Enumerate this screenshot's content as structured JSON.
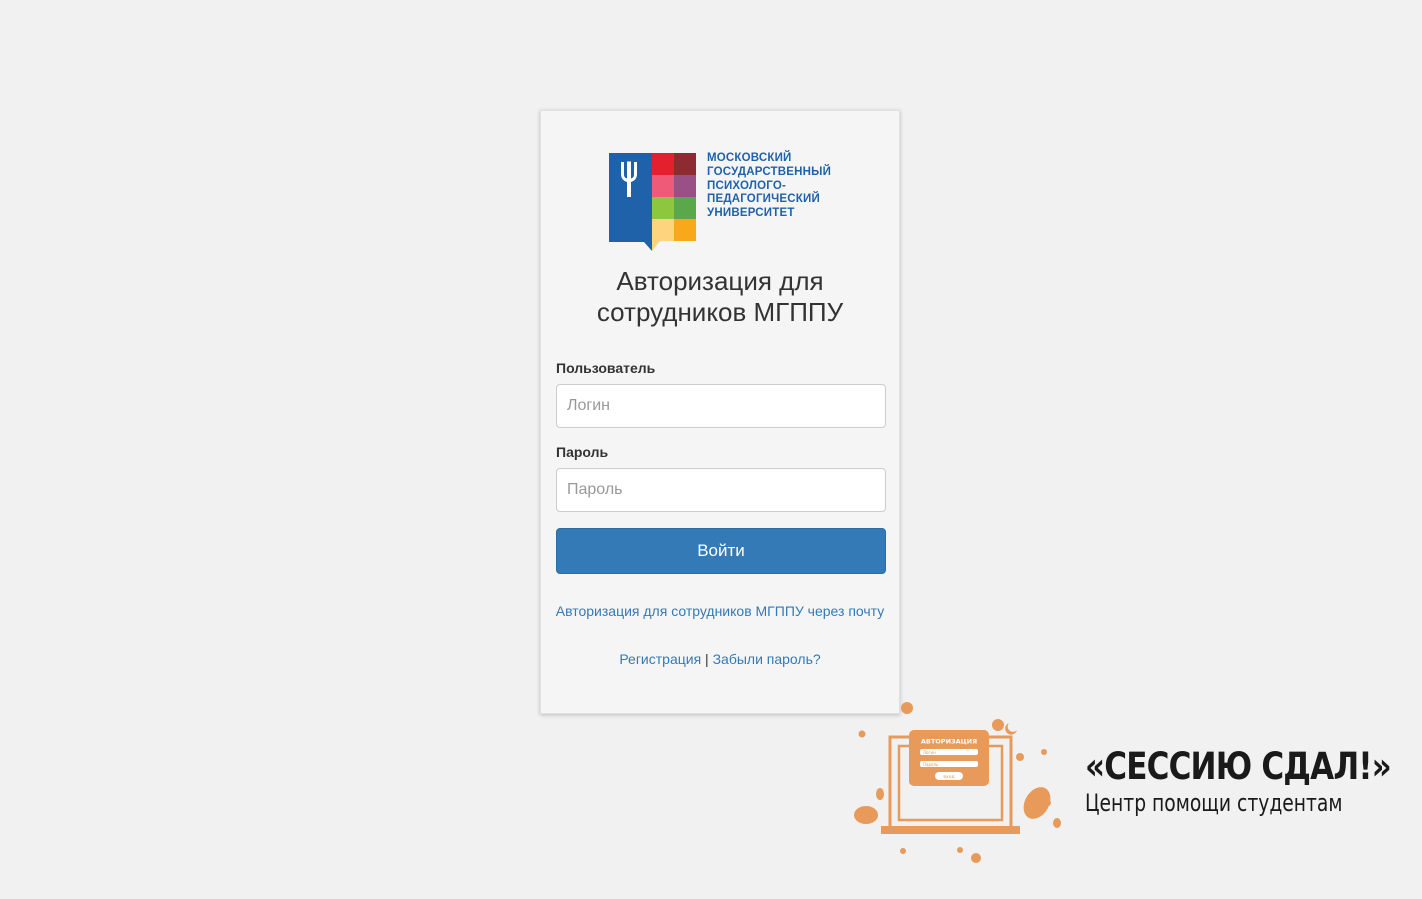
{
  "logo": {
    "lines": [
      "Московский",
      "государственный",
      "психолого-",
      "педагогический",
      "университет"
    ]
  },
  "title": "Авторизация для сотрудников МГППУ",
  "form": {
    "user_label": "Пользователь",
    "user_placeholder": "Логин",
    "password_label": "Пароль",
    "password_placeholder": "Пароль",
    "submit_label": "Войти"
  },
  "links": {
    "email_login": "Авторизация для сотрудников МГППУ через почту",
    "register": "Регистрация",
    "separator": "|",
    "forgot": "Забыли пароль?"
  },
  "promo": {
    "title": "«СЕССИЮ СДАЛ!»",
    "subtitle": "Центр помощи студентам",
    "illustration_title": "АВТОРИЗАЦИЯ",
    "illustration_field1": "Логин",
    "illustration_field2": "Пароль",
    "illustration_button": "вход"
  },
  "colors": {
    "page_bg": "#f1f1f1",
    "card_bg": "#f5f5f5",
    "accent": "#337ab7",
    "logo_blue": "#1f62aa",
    "promo_orange": "#e79a5a"
  }
}
